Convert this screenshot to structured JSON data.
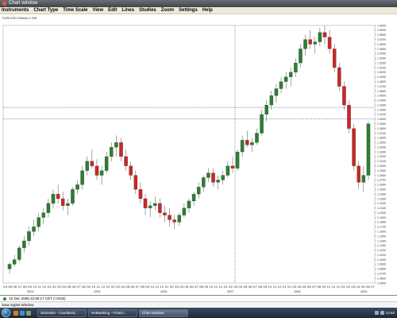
{
  "window": {
    "title": "Chart window"
  },
  "menu": [
    "Instruments",
    "Chart Type",
    "Time Scale",
    "View",
    "Edit",
    "Lines",
    "Studies",
    "Zoom",
    "Settings",
    "Help"
  ],
  "chart_header": "EUR/USD  Weekly  # 308",
  "chart_data": {
    "type": "candlestick",
    "symbol": "EUR/USD",
    "timeframe": "Weekly",
    "y_ticks": [
      "1.6000",
      "1.5900",
      "1.5800",
      "1.5700",
      "1.5600",
      "1.5500",
      "1.5400",
      "1.5300",
      "1.5200",
      "1.5100",
      "1.5000",
      "1.4900",
      "1.4800",
      "1.4700",
      "1.4600",
      "1.4500",
      "1.4400",
      "1.4300",
      "1.4200",
      "1.4100",
      "1.4000",
      "1.3900",
      "1.3800",
      "1.3700",
      "1.3600",
      "1.3500",
      "1.3400",
      "1.3300",
      "1.3200",
      "1.3100",
      "1.3000",
      "1.2900",
      "1.2800",
      "1.2700",
      "1.2600",
      "1.2500",
      "1.2400",
      "1.2300",
      "1.2200",
      "1.2100",
      "1.2000",
      "1.1900",
      "1.1800",
      "1.1700",
      "1.1600",
      "1.1500",
      "1.1400",
      "1.1300",
      "1.1200",
      "1.1100",
      "1.1000",
      "1.0900",
      "1.0800",
      "1.0700",
      "1.0600",
      "1.0500"
    ],
    "x_month_ticks": "04 05 06 07 08 09 10 11 12 01 02 03 04 05 06 07 08 09 10 11 12 01 02 03 04 05 06 07 08 09 10 11 12 01 02 03 04 05 06 07 08 09 10 11 12 01 02 03 04 05 06 07 08 09 10 11 12 01 02 03 04 05 06 07 08 09 10 11 12 01 02 03 04 05 06 07",
    "x_year_labels": [
      "2004",
      "2005",
      "2006",
      "2007",
      "2008",
      "2009"
    ],
    "ylim": [
      1.05,
      1.6
    ],
    "ohlc": [
      [
        1.08,
        1.095,
        1.07,
        1.09
      ],
      [
        1.09,
        1.11,
        1.085,
        1.1
      ],
      [
        1.1,
        1.13,
        1.095,
        1.125
      ],
      [
        1.125,
        1.15,
        1.115,
        1.14
      ],
      [
        1.14,
        1.17,
        1.13,
        1.16
      ],
      [
        1.16,
        1.185,
        1.15,
        1.17
      ],
      [
        1.17,
        1.2,
        1.16,
        1.19
      ],
      [
        1.19,
        1.21,
        1.175,
        1.2
      ],
      [
        1.2,
        1.23,
        1.19,
        1.22
      ],
      [
        1.22,
        1.25,
        1.21,
        1.24
      ],
      [
        1.24,
        1.26,
        1.22,
        1.23
      ],
      [
        1.23,
        1.245,
        1.205,
        1.215
      ],
      [
        1.215,
        1.23,
        1.195,
        1.22
      ],
      [
        1.22,
        1.255,
        1.215,
        1.25
      ],
      [
        1.25,
        1.27,
        1.24,
        1.26
      ],
      [
        1.26,
        1.3,
        1.25,
        1.29
      ],
      [
        1.29,
        1.32,
        1.28,
        1.31
      ],
      [
        1.31,
        1.335,
        1.295,
        1.3
      ],
      [
        1.3,
        1.315,
        1.27,
        1.28
      ],
      [
        1.28,
        1.3,
        1.26,
        1.29
      ],
      [
        1.29,
        1.33,
        1.285,
        1.32
      ],
      [
        1.32,
        1.35,
        1.31,
        1.34
      ],
      [
        1.34,
        1.365,
        1.32,
        1.35
      ],
      [
        1.35,
        1.36,
        1.31,
        1.32
      ],
      [
        1.32,
        1.335,
        1.29,
        1.3
      ],
      [
        1.3,
        1.31,
        1.27,
        1.28
      ],
      [
        1.28,
        1.29,
        1.24,
        1.25
      ],
      [
        1.25,
        1.265,
        1.22,
        1.23
      ],
      [
        1.23,
        1.24,
        1.195,
        1.21
      ],
      [
        1.21,
        1.225,
        1.19,
        1.215
      ],
      [
        1.215,
        1.235,
        1.205,
        1.22
      ],
      [
        1.22,
        1.23,
        1.19,
        1.2
      ],
      [
        1.2,
        1.215,
        1.18,
        1.195
      ],
      [
        1.195,
        1.21,
        1.17,
        1.185
      ],
      [
        1.185,
        1.195,
        1.165,
        1.18
      ],
      [
        1.18,
        1.2,
        1.172,
        1.195
      ],
      [
        1.195,
        1.22,
        1.19,
        1.21
      ],
      [
        1.21,
        1.23,
        1.2,
        1.225
      ],
      [
        1.225,
        1.245,
        1.215,
        1.24
      ],
      [
        1.24,
        1.265,
        1.23,
        1.255
      ],
      [
        1.255,
        1.28,
        1.245,
        1.275
      ],
      [
        1.275,
        1.295,
        1.265,
        1.285
      ],
      [
        1.285,
        1.295,
        1.255,
        1.265
      ],
      [
        1.265,
        1.28,
        1.25,
        1.27
      ],
      [
        1.27,
        1.29,
        1.26,
        1.28
      ],
      [
        1.28,
        1.31,
        1.275,
        1.3
      ],
      [
        1.3,
        1.32,
        1.285,
        1.295
      ],
      [
        1.295,
        1.335,
        1.29,
        1.33
      ],
      [
        1.33,
        1.365,
        1.32,
        1.355
      ],
      [
        1.355,
        1.375,
        1.34,
        1.345
      ],
      [
        1.345,
        1.36,
        1.33,
        1.35
      ],
      [
        1.35,
        1.38,
        1.345,
        1.37
      ],
      [
        1.37,
        1.42,
        1.365,
        1.41
      ],
      [
        1.41,
        1.44,
        1.395,
        1.43
      ],
      [
        1.43,
        1.46,
        1.42,
        1.45
      ],
      [
        1.45,
        1.475,
        1.435,
        1.465
      ],
      [
        1.465,
        1.49,
        1.455,
        1.48
      ],
      [
        1.48,
        1.5,
        1.465,
        1.49
      ],
      [
        1.49,
        1.51,
        1.47,
        1.5
      ],
      [
        1.5,
        1.53,
        1.49,
        1.52
      ],
      [
        1.52,
        1.56,
        1.51,
        1.55
      ],
      [
        1.55,
        1.58,
        1.535,
        1.57
      ],
      [
        1.57,
        1.59,
        1.55,
        1.56
      ],
      [
        1.56,
        1.575,
        1.54,
        1.565
      ],
      [
        1.565,
        1.595,
        1.555,
        1.585
      ],
      [
        1.585,
        1.6,
        1.56,
        1.575
      ],
      [
        1.575,
        1.59,
        1.54,
        1.55
      ],
      [
        1.55,
        1.56,
        1.5,
        1.51
      ],
      [
        1.51,
        1.52,
        1.46,
        1.47
      ],
      [
        1.47,
        1.48,
        1.42,
        1.43
      ],
      [
        1.43,
        1.44,
        1.37,
        1.38
      ],
      [
        1.38,
        1.39,
        1.29,
        1.3
      ],
      [
        1.3,
        1.31,
        1.25,
        1.265
      ],
      [
        1.265,
        1.3,
        1.245,
        1.28
      ],
      [
        1.28,
        1.395,
        1.27,
        1.39
      ]
    ],
    "horizontal_lines": [
      1.425,
      1.4
    ],
    "crosshair_x_label": "2007"
  },
  "status": {
    "text": "10 Dec 2008 22:59:17 CET (+0100)"
  },
  "applet_text": "Java Applet Window",
  "taskbar": {
    "buttons": [
      "Startseite - Candlestic...",
      "NetBanking - Finanz...",
      "Chart window"
    ],
    "clock": "12:52"
  },
  "colors": {
    "up": "#2e7d32",
    "down": "#c62828",
    "line": "#3344aa",
    "crosshair": "#555555"
  }
}
